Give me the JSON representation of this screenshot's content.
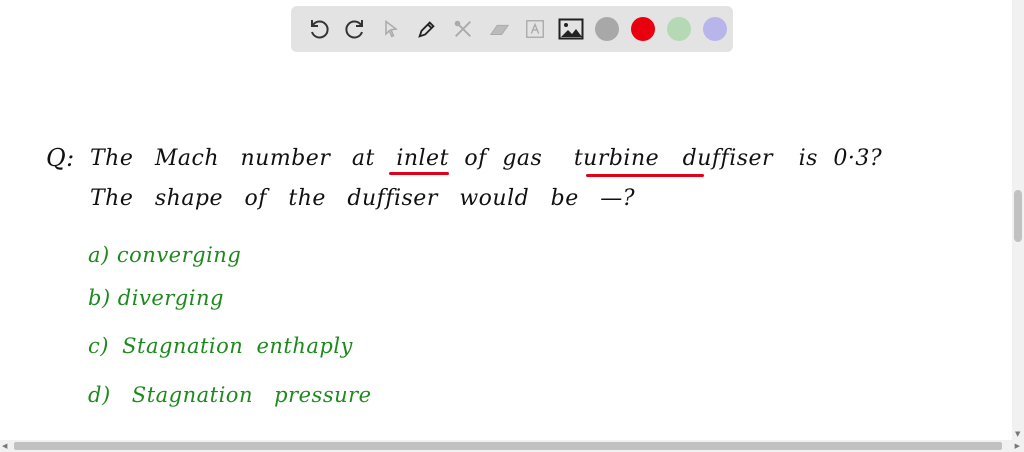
{
  "toolbar": {
    "tools": [
      {
        "icon": "undo-icon"
      },
      {
        "icon": "redo-icon"
      },
      {
        "icon": "select-pointer-icon"
      },
      {
        "icon": "pen-icon"
      },
      {
        "icon": "tools-icon"
      },
      {
        "icon": "eraser-icon"
      },
      {
        "icon": "text-box-icon"
      },
      {
        "icon": "image-icon"
      }
    ],
    "colors": [
      "#a8a8a8",
      "#e8000f",
      "#b5d8b5",
      "#b8b5ea"
    ]
  },
  "question": {
    "label": "Q:",
    "line1": [
      "The",
      "Mach",
      "number",
      "at",
      "inlet",
      "of",
      "gas",
      "turbine",
      "duffiser",
      "is",
      "0·3?"
    ],
    "line2": "The shape of the duffiser would be —?"
  },
  "options": [
    "a) converging",
    "b) diverging",
    "c) Stagnation enthaply",
    "d) Stagnation pressure"
  ],
  "colors": {
    "question_ink": "#111111",
    "answer_ink": "#1e8a1e",
    "highlight": "#e0001b"
  }
}
